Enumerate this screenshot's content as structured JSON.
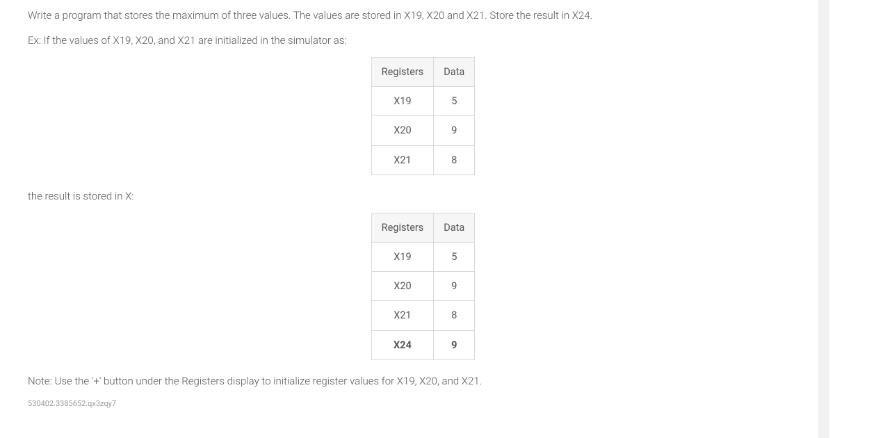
{
  "paragraphs": {
    "intro": "Write a program that stores the maximum of three values. The values are stored in X19, X20 and X21. Store the result in X24.",
    "example_lead": "Ex: If the values of X19, X20, and X21 are initialized in the simulator as:",
    "result_lead": "the result is stored in X:",
    "note": "Note: Use the '+' button under the Registers display to initialize register values for X19, X20, and X21."
  },
  "table_headers": {
    "col1": "Registers",
    "col2": "Data"
  },
  "table1": [
    {
      "reg": "X19",
      "val": "5"
    },
    {
      "reg": "X20",
      "val": "9"
    },
    {
      "reg": "X21",
      "val": "8"
    }
  ],
  "table2": [
    {
      "reg": "X19",
      "val": "5",
      "bold": false
    },
    {
      "reg": "X20",
      "val": "9",
      "bold": false
    },
    {
      "reg": "X21",
      "val": "8",
      "bold": false
    },
    {
      "reg": "X24",
      "val": "9",
      "bold": true
    }
  ],
  "footer_code": "530402.3385652.qx3zqy7"
}
